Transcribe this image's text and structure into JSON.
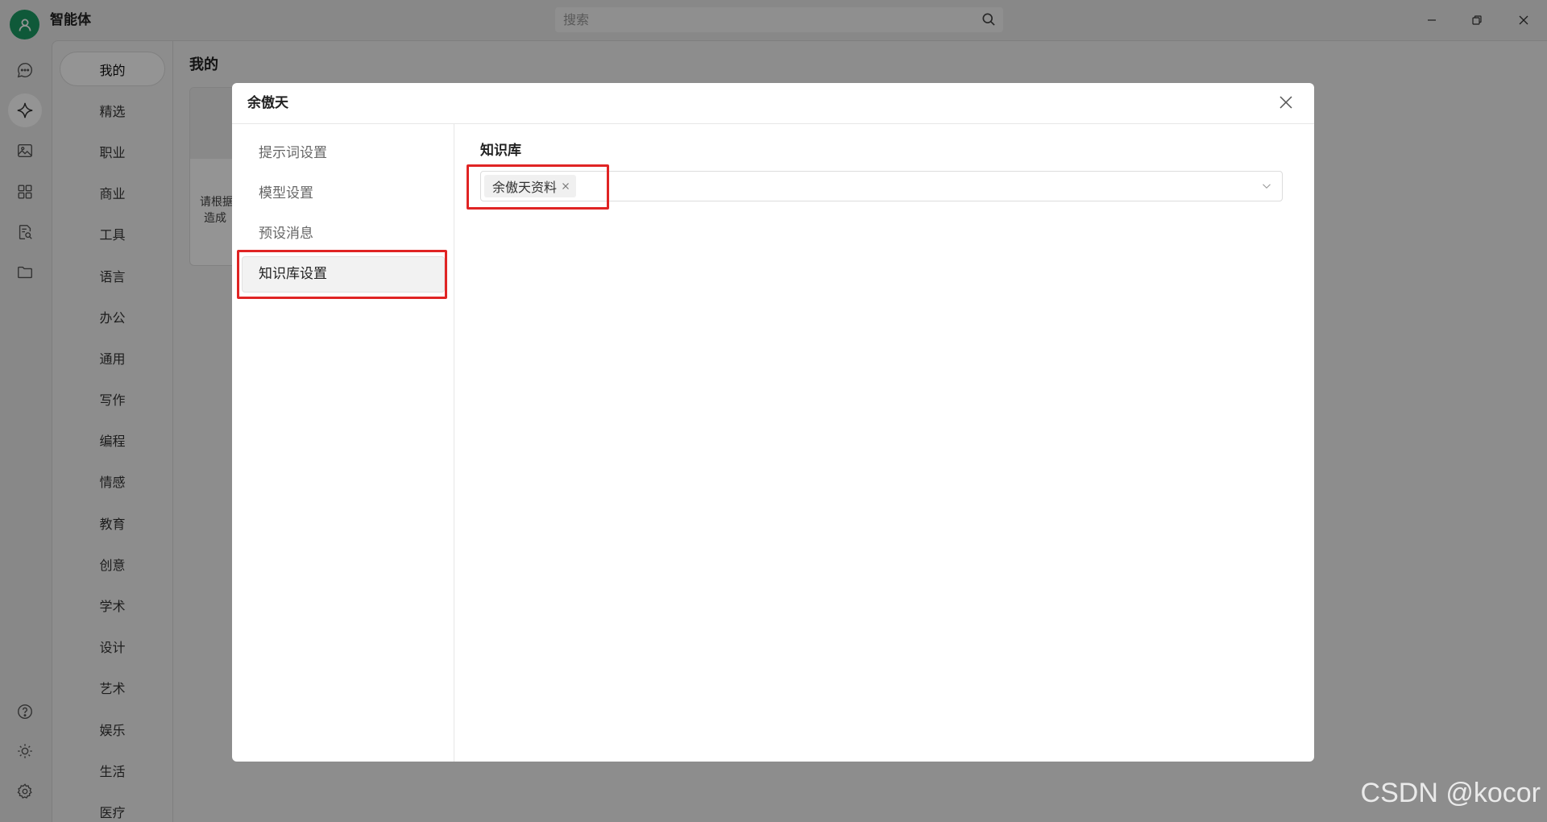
{
  "app": {
    "title": "智能体"
  },
  "search": {
    "placeholder": "搜索",
    "icon": "search-icon"
  },
  "window_controls": [
    "minimize-icon",
    "restore-icon",
    "close-icon"
  ],
  "rail": {
    "top_icons": [
      "chat-icon",
      "sparkle-icon",
      "image-icon",
      "grid-icon",
      "document-search-icon",
      "folder-icon"
    ],
    "bottom_icons": [
      "help-icon",
      "sun-icon",
      "gear-icon"
    ],
    "selected": "sparkle-icon"
  },
  "categories": {
    "selected": "我的",
    "items": [
      "我的",
      "精选",
      "职业",
      "商业",
      "工具",
      "语言",
      "办公",
      "通用",
      "写作",
      "编程",
      "情感",
      "教育",
      "创意",
      "学术",
      "设计",
      "艺术",
      "娱乐",
      "生活",
      "医疗"
    ]
  },
  "main": {
    "heading": "我的",
    "card": {
      "lines": [
        "请根据",
        "造成"
      ]
    }
  },
  "modal": {
    "title": "余傲天",
    "menu": [
      "提示词设置",
      "模型设置",
      "预设消息",
      "知识库设置"
    ],
    "selected_menu": "知识库设置",
    "knowledge": {
      "label": "知识库",
      "tags": [
        "余傲天资料"
      ]
    }
  },
  "watermark": "CSDN @kocor",
  "colors": {
    "accent": "#1a9a62",
    "highlight": "#e02424",
    "overlay": "rgba(0,0,0,0.42)"
  }
}
